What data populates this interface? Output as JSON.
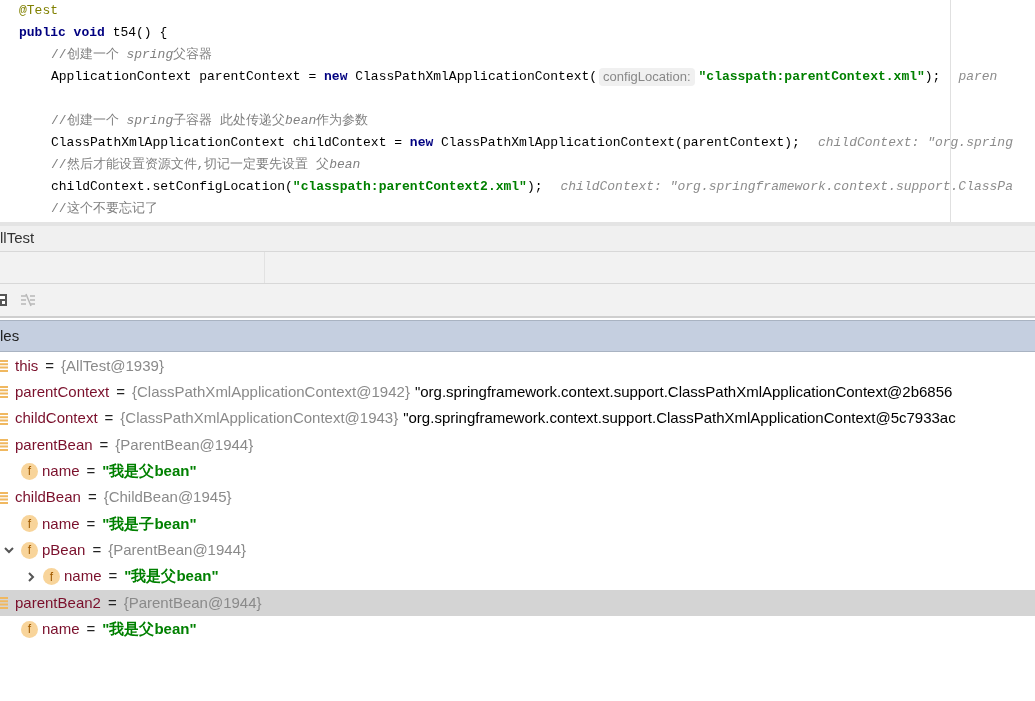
{
  "code_lines": [
    {
      "kind": "code",
      "segments": [
        {
          "kind": "annotation",
          "text": "@Test"
        }
      ]
    },
    {
      "kind": "code",
      "segments": [
        {
          "kind": "keyword",
          "text": "public void"
        },
        {
          "kind": "plain",
          "text": " t54() {"
        }
      ],
      "children": [
        {
          "kind": "code",
          "segments": [
            {
              "kind": "comment",
              "text": "//创建一个 "
            },
            {
              "kind": "comment_italic",
              "text": "spring"
            },
            {
              "kind": "comment",
              "text": "父容器"
            }
          ]
        },
        {
          "kind": "code",
          "segments": [
            {
              "kind": "plain",
              "text": "ApplicationContext parentContext = "
            },
            {
              "kind": "keyword",
              "text": "new"
            },
            {
              "kind": "plain",
              "text": " ClassPathXmlApplicationContext("
            },
            {
              "kind": "param_hint",
              "text": "configLocation:"
            },
            {
              "kind": "string",
              "text": "\"classpath:parentContext.xml\""
            },
            {
              "kind": "plain",
              "text": ");"
            },
            {
              "kind": "value_hint",
              "text": "paren"
            }
          ]
        },
        {
          "kind": "blank"
        },
        {
          "kind": "code",
          "segments": [
            {
              "kind": "comment",
              "text": "//创建一个 "
            },
            {
              "kind": "comment_italic",
              "text": "spring"
            },
            {
              "kind": "comment",
              "text": "子容器 此处传递父"
            },
            {
              "kind": "comment_italic",
              "text": "bean"
            },
            {
              "kind": "comment",
              "text": "作为参数"
            }
          ]
        },
        {
          "kind": "code",
          "segments": [
            {
              "kind": "plain",
              "text": "ClassPathXmlApplicationContext childContext = "
            },
            {
              "kind": "keyword",
              "text": "new"
            },
            {
              "kind": "plain",
              "text": " ClassPathXmlApplicationContext(parentContext);"
            },
            {
              "kind": "value_hint",
              "text": "childContext: \"org.spring"
            }
          ]
        },
        {
          "kind": "code",
          "segments": [
            {
              "kind": "comment",
              "text": "//然后才能设置资源文件,切记一定要先设置 父"
            },
            {
              "kind": "comment_italic",
              "text": "bean"
            }
          ]
        },
        {
          "kind": "code",
          "segments": [
            {
              "kind": "plain",
              "text": "childContext.setConfigLocation("
            },
            {
              "kind": "string",
              "text": "\"classpath:parentContext2.xml\""
            },
            {
              "kind": "plain",
              "text": ");"
            },
            {
              "kind": "value_hint",
              "text": "childContext: \"org.springframework.context.support.ClassPa"
            }
          ]
        },
        {
          "kind": "code",
          "segments": [
            {
              "kind": "comment",
              "text": "//这个不要忘记了"
            }
          ]
        }
      ]
    }
  ],
  "debug_panel": {
    "title": "llTest",
    "variables_header": "les"
  },
  "variables": [
    {
      "kind": "local",
      "name": "this",
      "operator": "=",
      "ref": "{AllTest@1939}",
      "selected": false
    },
    {
      "kind": "local",
      "name": "parentContext",
      "operator": "=",
      "ref": "{ClassPathXmlApplicationContext@1942}",
      "description": "\"org.springframework.context.support.ClassPathXmlApplicationContext@2b6856",
      "selected": false
    },
    {
      "kind": "local",
      "name": "childContext",
      "operator": "=",
      "ref": "{ClassPathXmlApplicationContext@1943}",
      "description": "\"org.springframework.context.support.ClassPathXmlApplicationContext@5c7933ac",
      "selected": false
    },
    {
      "kind": "local",
      "name": "parentBean",
      "operator": "=",
      "ref": "{ParentBean@1944}",
      "selected": false,
      "children": [
        {
          "kind": "field",
          "icon_letter": "f",
          "name": "name",
          "operator": "=",
          "string_value": "\"我是父bean\"",
          "selected": false
        }
      ]
    },
    {
      "kind": "local",
      "name": "childBean",
      "operator": "=",
      "ref": "{ChildBean@1945}",
      "selected": false,
      "children": [
        {
          "kind": "field",
          "icon_letter": "f",
          "name": "name",
          "operator": "=",
          "string_value": "\"我是子bean\"",
          "selected": false
        },
        {
          "kind": "field",
          "icon_letter": "f",
          "name": "pBean",
          "operator": "=",
          "ref": "{ParentBean@1944}",
          "selected": false,
          "expanded": true,
          "children": [
            {
              "kind": "field",
              "icon_letter": "f",
              "name": "name",
              "operator": "=",
              "string_value": "\"我是父bean\"",
              "selected": false,
              "expanded": false
            }
          ]
        }
      ]
    },
    {
      "kind": "local",
      "name": "parentBean2",
      "operator": "=",
      "ref": "{ParentBean@1944}",
      "selected": true,
      "children": [
        {
          "kind": "field",
          "icon_letter": "f",
          "name": "name",
          "operator": "=",
          "string_value": "\"我是父bean\"",
          "selected": false
        }
      ]
    }
  ]
}
